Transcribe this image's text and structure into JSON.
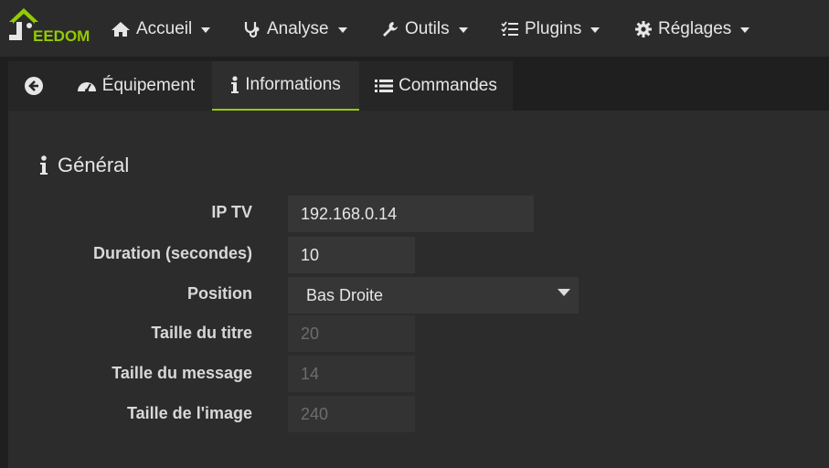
{
  "brand": {
    "logo_text": "EEDOM",
    "accent": "#94ca02"
  },
  "navbar": {
    "items": [
      {
        "label": "Accueil",
        "icon": "home-icon"
      },
      {
        "label": "Analyse",
        "icon": "stethoscope-icon"
      },
      {
        "label": "Outils",
        "icon": "wrench-icon"
      },
      {
        "label": "Plugins",
        "icon": "tasks-list-icon"
      },
      {
        "label": "Réglages",
        "icon": "gear-icon"
      }
    ]
  },
  "tabs": [
    {
      "label": "",
      "icon": "back-arrow-circle-icon"
    },
    {
      "label": "Équipement",
      "icon": "dashboard-gauge-icon"
    },
    {
      "label": "Informations",
      "icon": "info-icon",
      "active": true
    },
    {
      "label": "Commandes",
      "icon": "list-icon"
    }
  ],
  "section": {
    "title": "Général",
    "icon": "info-icon"
  },
  "form": {
    "fields": [
      {
        "label": "IP TV",
        "value": "192.168.0.14"
      },
      {
        "label": "Duration (secondes)",
        "value": "10"
      },
      {
        "label": "Position",
        "value": "Bas Droite"
      },
      {
        "label": "Taille du titre",
        "placeholder": "20"
      },
      {
        "label": "Taille du message",
        "placeholder": "14"
      },
      {
        "label": "Taille de l'image",
        "placeholder": "240"
      }
    ]
  }
}
